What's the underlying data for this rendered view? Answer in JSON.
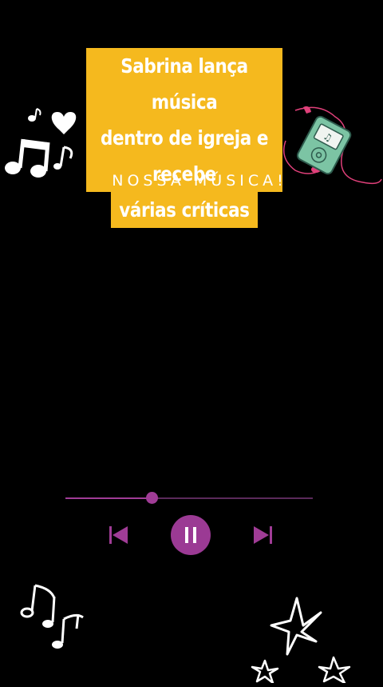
{
  "headline": {
    "lines": [
      "Sabrina lança música",
      "dentro de igreja e recebe",
      "várias críticas"
    ],
    "background": "#f5b91e"
  },
  "subtitle": "NOSSA MÚSICA!",
  "player": {
    "progress": 0.35,
    "accent": "#a03c96",
    "prev_icon": "skip-previous-icon",
    "pause_icon": "pause-icon",
    "next_icon": "skip-next-icon"
  },
  "decorations": {
    "top_left": "music-notes-icon",
    "top_right": "mp3-player-icon",
    "bottom_left": "music-notes-icon",
    "bottom_right": "stars-icon"
  }
}
